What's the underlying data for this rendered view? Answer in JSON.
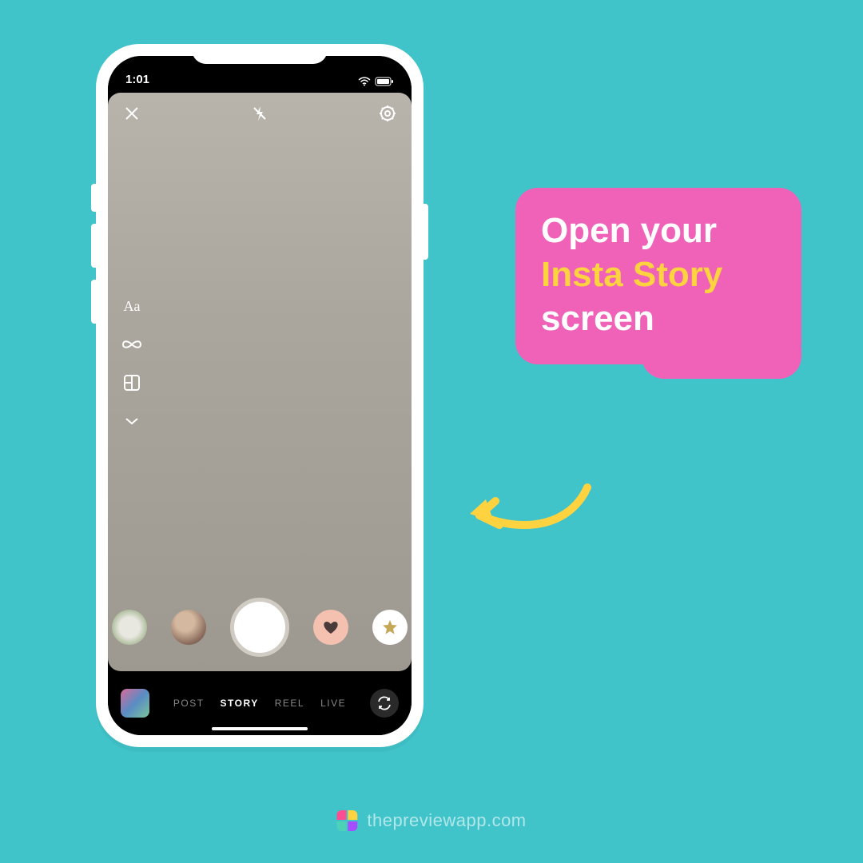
{
  "status": {
    "time": "1:01"
  },
  "top_icons": {
    "close": "close",
    "flash": "flash-off",
    "settings": "settings"
  },
  "rail": {
    "text_label": "Aa",
    "boomerang": "infinity",
    "layout": "layout-grid",
    "more": "chevron-down"
  },
  "filters": {
    "plant": "plant-filter",
    "avatar": "avatar-filter",
    "heart": "heart-filter",
    "star": "star-filter"
  },
  "modes": {
    "items": [
      "POST",
      "STORY",
      "REEL",
      "LIVE"
    ],
    "active_index": 1
  },
  "callout": {
    "line1": "Open your",
    "line2": "Insta Story",
    "line3": "screen"
  },
  "watermark": {
    "text": "thepreviewapp.com"
  }
}
